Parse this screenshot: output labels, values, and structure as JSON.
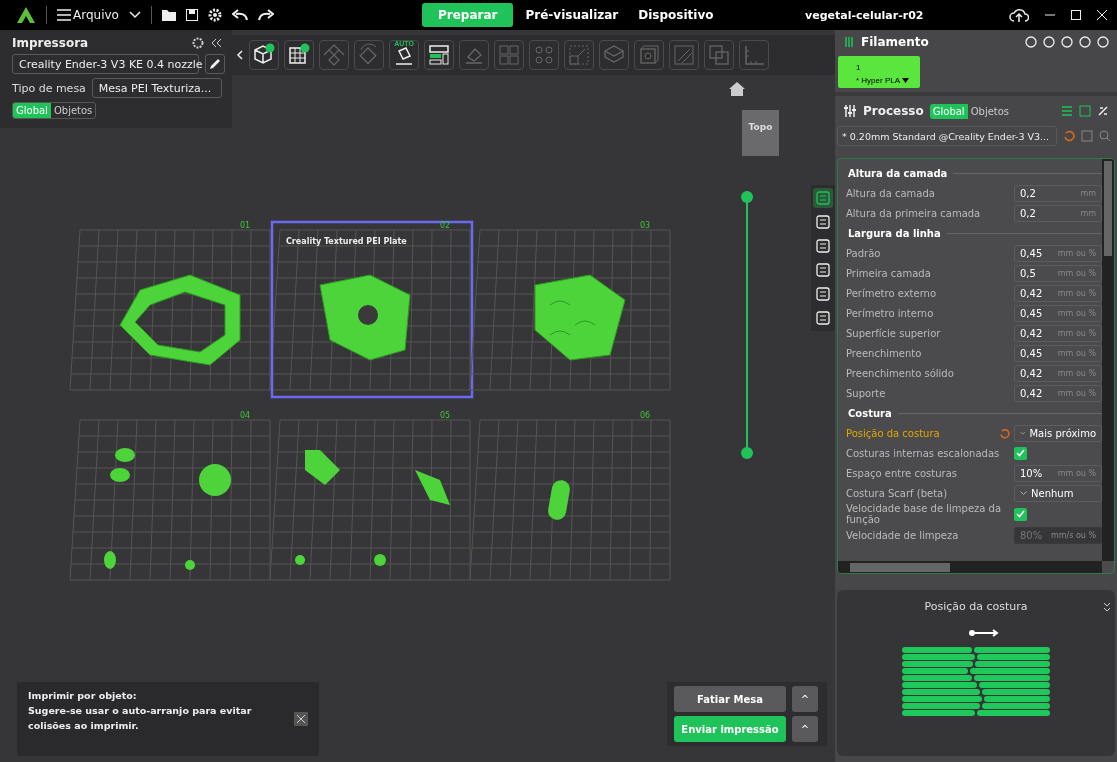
{
  "topbar": {
    "menu": "Arquivo",
    "tabs": [
      {
        "label": "Preparar",
        "selected": true
      },
      {
        "label": "Pré-visualizar",
        "selected": false
      },
      {
        "label": "Dispositivo",
        "selected": false
      }
    ],
    "title": "vegetal-celular-r02"
  },
  "printer_panel": {
    "title": "Impressora",
    "printer": "Creality Ender-3 V3 KE 0.4 nozzle",
    "bed_label": "Tipo de mesa",
    "bed": "Mesa PEI Texturiza...",
    "scope": [
      {
        "label": "Global",
        "selected": true
      },
      {
        "label": "Objetos",
        "selected": false
      }
    ]
  },
  "toolbar": [
    {
      "kind": "add-cube",
      "disabled": false
    },
    {
      "kind": "add-plate",
      "disabled": false
    },
    {
      "kind": "move",
      "disabled": true
    },
    {
      "kind": "rotate",
      "disabled": true
    },
    {
      "kind": "auto-orient",
      "disabled": false,
      "label": "AUTO"
    },
    {
      "kind": "arrange",
      "disabled": false
    },
    {
      "kind": "lay-flat",
      "disabled": true
    },
    {
      "kind": "split",
      "disabled": true
    },
    {
      "kind": "grid",
      "disabled": true
    },
    {
      "kind": "scale",
      "disabled": true
    },
    {
      "kind": "box",
      "disabled": true
    },
    {
      "kind": "cube",
      "disabled": true
    },
    {
      "kind": "cut",
      "disabled": true
    },
    {
      "kind": "boolean",
      "disabled": true
    },
    {
      "kind": "measure",
      "disabled": true
    }
  ],
  "view_cube": {
    "face": "Topo"
  },
  "layer_slider": {
    "level": 1
  },
  "plates": [
    {
      "label": "01",
      "selected": false
    },
    {
      "label": "02",
      "selected": true,
      "caption": "Creality Textured PEI Plate"
    },
    {
      "label": "03",
      "selected": false
    },
    {
      "label": "04",
      "selected": false
    },
    {
      "label": "05",
      "selected": false
    },
    {
      "label": "06",
      "selected": false
    }
  ],
  "side_tools": [
    {
      "selected": true
    },
    {
      "selected": false
    },
    {
      "selected": false
    },
    {
      "selected": false
    },
    {
      "selected": false
    },
    {
      "selected": false
    }
  ],
  "notification": {
    "title": "Imprimir por objeto:",
    "text": "Sugere-se usar o auto-arranjo para evitar colisões ao imprimir."
  },
  "actions": [
    {
      "label": "Fatiar Mesa",
      "kind": "secondary",
      "more": "^"
    },
    {
      "label": "Enviar impressão",
      "kind": "primary",
      "more": "^"
    }
  ],
  "filament": {
    "title": "Filamento",
    "slots": [
      {
        "index": "1",
        "name": "* Hyper PLA",
        "color": "#5ae63c"
      }
    ]
  },
  "process": {
    "title": "Processo",
    "scope": [
      {
        "label": "Global",
        "selected": true
      },
      {
        "label": "Objetos",
        "selected": false
      }
    ],
    "preset": "* 0.20mm Standard @Creality Ender-3 V3..."
  },
  "settings": [
    {
      "section": "Altura da camada",
      "rows": [
        {
          "kind": "number",
          "label": "Altura da camada",
          "value": "0,2",
          "unit": "mm",
          "modified": false,
          "disabled": false
        },
        {
          "kind": "number",
          "label": "Altura da primeira camada",
          "value": "0,2",
          "unit": "mm",
          "modified": false,
          "disabled": false
        }
      ]
    },
    {
      "section": "Largura da linha",
      "rows": [
        {
          "kind": "number",
          "label": "Padrão",
          "value": "0,45",
          "unit": "mm ou %",
          "modified": false,
          "disabled": false
        },
        {
          "kind": "number",
          "label": "Primeira camada",
          "value": "0,5",
          "unit": "mm ou %",
          "modified": false,
          "disabled": false
        },
        {
          "kind": "number",
          "label": "Perímetro externo",
          "value": "0,42",
          "unit": "mm ou %",
          "modified": false,
          "disabled": false
        },
        {
          "kind": "number",
          "label": "Perímetro interno",
          "value": "0,45",
          "unit": "mm ou %",
          "modified": false,
          "disabled": false
        },
        {
          "kind": "number",
          "label": "Superfície superior",
          "value": "0,42",
          "unit": "mm ou %",
          "modified": false,
          "disabled": false
        },
        {
          "kind": "number",
          "label": "Preenchimento",
          "value": "0,45",
          "unit": "mm ou %",
          "modified": false,
          "disabled": false
        },
        {
          "kind": "number",
          "label": "Preenchimento sólido",
          "value": "0,42",
          "unit": "mm ou %",
          "modified": false,
          "disabled": false
        },
        {
          "kind": "number",
          "label": "Suporte",
          "value": "0,42",
          "unit": "mm ou %",
          "modified": false,
          "disabled": false
        }
      ]
    },
    {
      "section": "Costura",
      "rows": [
        {
          "kind": "dropdown",
          "label": "Posição da costura",
          "value": "Mais próximo",
          "modified": true
        },
        {
          "kind": "checkbox",
          "label": "Costuras internas escalonadas",
          "checked": true,
          "modified": false
        },
        {
          "kind": "number",
          "label": "Espaço entre costuras",
          "value": "10%",
          "unit": "mm ou %",
          "modified": false,
          "disabled": false
        },
        {
          "kind": "dropdown",
          "label": "Costura Scarf (beta)",
          "value": "Nenhum",
          "modified": false
        },
        {
          "kind": "checkbox",
          "label": "Velocidade base de limpeza da função",
          "checked": true,
          "modified": false
        },
        {
          "kind": "number",
          "label": "Velocidade de limpeza",
          "value": "80%",
          "unit": "mm/s ou %",
          "modified": false,
          "disabled": true
        }
      ]
    }
  ],
  "preview": {
    "title": "Posição da costura"
  }
}
